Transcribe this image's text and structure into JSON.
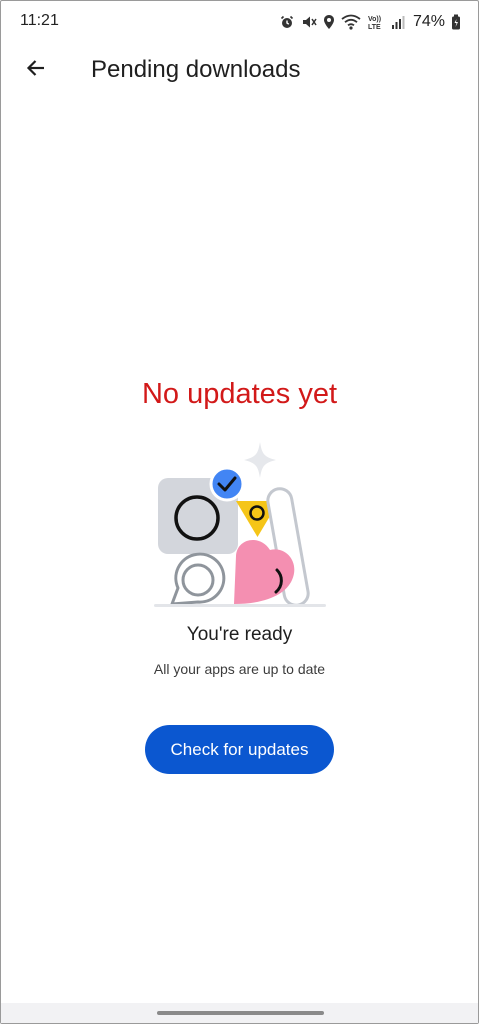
{
  "status_bar": {
    "time": "11:21",
    "battery_percent": "74%",
    "icons": [
      "alarm-icon",
      "mute-icon",
      "location-icon",
      "wifi-icon",
      "volte-icon",
      "signal-icon",
      "battery-icon"
    ],
    "volte_text": "VoLTE"
  },
  "app_bar": {
    "back_icon": "arrow-left-icon",
    "title": "Pending downloads"
  },
  "content": {
    "headline": "No updates yet",
    "headline_color": "#d21919",
    "illustration": "apps-up-to-date-illustration",
    "ready_title": "You're ready",
    "ready_subtitle": "All your apps are up to date",
    "button_label": "Check for updates",
    "button_color": "#0b57d0"
  }
}
